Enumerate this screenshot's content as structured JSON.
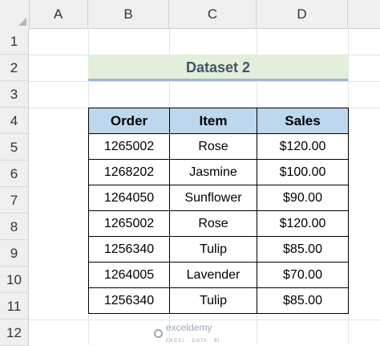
{
  "columns": [
    "A",
    "B",
    "C",
    "D"
  ],
  "rows": [
    "1",
    "2",
    "3",
    "4",
    "5",
    "6",
    "7",
    "8",
    "9",
    "10",
    "11",
    "12"
  ],
  "title": "Dataset 2",
  "table": {
    "headers": [
      "Order",
      "Item",
      "Sales"
    ],
    "rows": [
      [
        "1265002",
        "Rose",
        "$120.00"
      ],
      [
        "1268202",
        "Jasmine",
        "$100.00"
      ],
      [
        "1264050",
        "Sunflower",
        "$90.00"
      ],
      [
        "1265002",
        "Rose",
        "$120.00"
      ],
      [
        "1256340",
        "Tulip",
        "$85.00"
      ],
      [
        "1264005",
        "Lavender",
        "$70.00"
      ],
      [
        "1256340",
        "Tulip",
        "$85.00"
      ]
    ]
  },
  "watermark": {
    "name": "exceldemy",
    "tagline": "EXCEL · DATA · BI",
    "icon": "exceldemy-logo-icon"
  }
}
